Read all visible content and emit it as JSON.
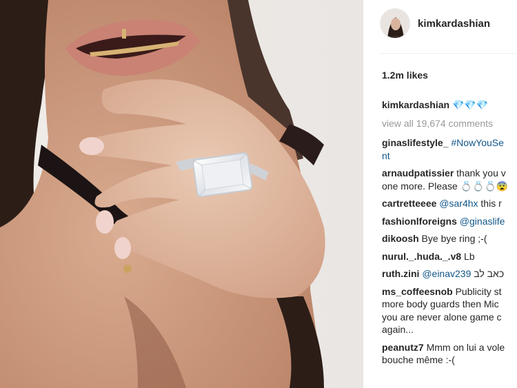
{
  "post": {
    "username": "kimkardashian",
    "likes": "1.2m likes",
    "caption_user": "kimkardashian",
    "caption_text": "💎💎💎",
    "view_all": "view all 19,674 comments",
    "comments": [
      {
        "user": "ginaslifestyle_",
        "lines": [
          [
            "tag",
            " #NowYouSe"
          ],
          [
            "tag",
            "nt"
          ]
        ]
      },
      {
        "user": "arnaudpatissier",
        "lines": [
          [
            "txt",
            " thank you v"
          ],
          [
            "txt",
            "one more. Please 💍💍💍😨"
          ]
        ]
      },
      {
        "user": "cartretteeee",
        "lines": [
          [
            "tag",
            " @sar4hx"
          ],
          [
            "txt",
            " this r"
          ]
        ]
      },
      {
        "user": "fashionlforeigns",
        "lines": [
          [
            "tag",
            " @ginaslife"
          ]
        ]
      },
      {
        "user": "dikoosh",
        "lines": [
          [
            "txt",
            " Bye bye ring ;-("
          ]
        ]
      },
      {
        "user": "nurul._.huda._.v8",
        "lines": [
          [
            "txt",
            " Lb"
          ]
        ]
      },
      {
        "user": "ruth.zini",
        "lines": [
          [
            "tag",
            " @einav239"
          ],
          [
            "txt",
            " כאב לב"
          ]
        ]
      },
      {
        "user": "ms_coffeesnob",
        "lines": [
          [
            "txt",
            " Publicity st"
          ],
          [
            "txt",
            "more body guards then Mic"
          ],
          [
            "txt",
            "you are never alone game c"
          ],
          [
            "txt",
            "again..."
          ]
        ]
      },
      {
        "user": "peanutz7",
        "lines": [
          [
            "txt",
            " Mmm on lui a vole"
          ],
          [
            "txt",
            "bouche même :-("
          ]
        ]
      }
    ]
  },
  "colors": {
    "link": "#125688",
    "muted": "#999999",
    "text": "#262626"
  }
}
